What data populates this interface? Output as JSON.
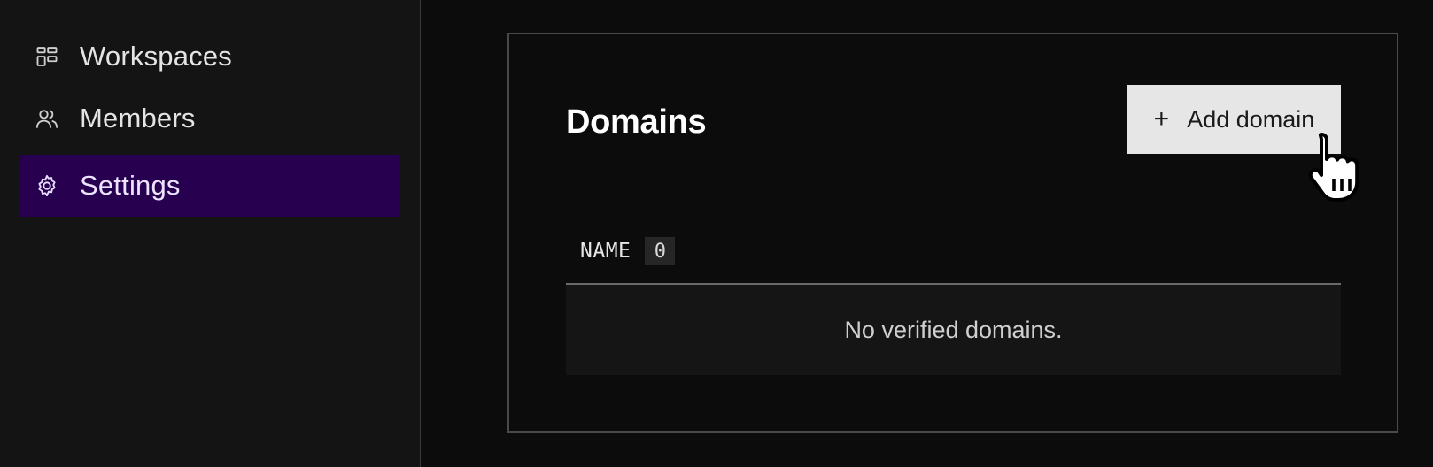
{
  "sidebar": {
    "items": [
      {
        "label": "Workspaces",
        "icon": "workspaces-grid-icon",
        "active": false
      },
      {
        "label": "Members",
        "icon": "members-icon",
        "active": false
      },
      {
        "label": "Settings",
        "icon": "gear-icon",
        "active": true
      }
    ]
  },
  "domains": {
    "title": "Domains",
    "add_button_label": "Add domain",
    "add_button_icon": "plus-icon",
    "plus_glyph": "+",
    "column_name": "NAME",
    "count": "0",
    "empty_message": "No verified domains."
  },
  "colors": {
    "active_nav_bg": "#27004f",
    "button_bg": "#e6e6e6",
    "page_bg": "#0c0c0c",
    "sidebar_bg": "#141414"
  }
}
